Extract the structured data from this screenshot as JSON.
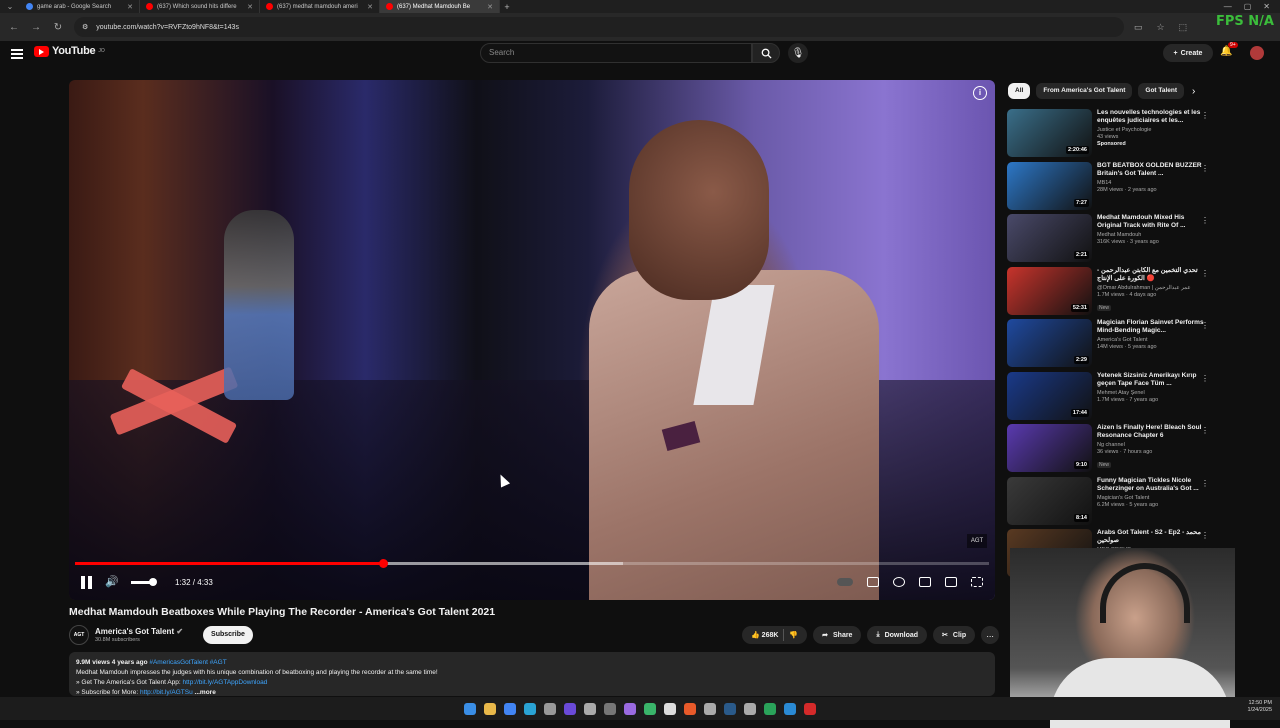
{
  "browser": {
    "tabs": [
      {
        "label": "game arab - Google Search",
        "color": "#4285f4",
        "active": false
      },
      {
        "label": "(637) Which sound hits differe",
        "color": "#ff0000",
        "active": false
      },
      {
        "label": "(637) medhat mamdouh ameri",
        "color": "#ff0000",
        "active": false
      },
      {
        "label": "(637) Medhat Mamdouh Be",
        "color": "#ff0000",
        "active": true
      }
    ],
    "url": "youtube.com/watch?v=RVFZto9hNF8&t=143s",
    "overlay_text": "FPS N/A"
  },
  "masthead": {
    "logo_text": "YouTube",
    "logo_sup": "JO",
    "search_placeholder": "Search",
    "create_label": "Create",
    "notification_count": "9+"
  },
  "player": {
    "current_time": "1:32",
    "duration": "4:33",
    "time_display": "1:32 / 4:33",
    "progress": 0.337,
    "buffered": 0.6,
    "volume": 0.35,
    "watermark": "AGT"
  },
  "video": {
    "title": "Medhat Mamdouh Beatboxes While Playing The Recorder - America's Got Talent 2021",
    "channel_name": "America's Got Talent",
    "channel_avatar_text": "AGT",
    "subscribers": "30.8M subscribers",
    "subscribe_label": "Subscribe",
    "likes": "268K",
    "share_label": "Share",
    "download_label": "Download",
    "clip_label": "Clip",
    "more_label": "...",
    "views_date": "9.9M views  4 years ago",
    "hashtags": "#AmericasGotTalent #AGT",
    "description_line1": "Medhat Mamdouh impresses the judges with his unique combination of beatboxing and playing the recorder at the same time!",
    "description_line2_prefix": "» Get The America's Got Talent App: ",
    "description_line2_link": "http://bit.ly/AGTAppDownload",
    "description_line3_prefix": "» Subscribe for More: ",
    "description_line3_link": "http://bit.ly/AGTSu",
    "description_more": "...more"
  },
  "chips": [
    "All",
    "From America's Got Talent",
    "Got Talent"
  ],
  "recommendations": [
    {
      "title": "Les nouvelles technologies et les enquêtes judiciaires et les...",
      "channel": "Justice et Psychologie",
      "meta": "43 views",
      "duration": "2:20:46",
      "extra": "Sponsored",
      "thumb": "#3a6f8a"
    },
    {
      "title": "BGT BEATBOX GOLDEN BUZZER Britain's Got Talent ...",
      "channel": "MB14",
      "meta": "28M views · 2 years ago",
      "duration": "7:27",
      "extra": "",
      "thumb": "#2d78c8"
    },
    {
      "title": "Medhat Mamdouh Mixed His Original Track with Rite Of ...",
      "channel": "Medhat Mamdouh",
      "meta": "316K views · 3 years ago",
      "duration": "2:21",
      "extra": "",
      "thumb": "#4a4a6a"
    },
    {
      "title": "تحدي التخمين مع الكابتن عبدالرحمن - الكورة على الإنتاج 🔴",
      "channel": "@Omar Abdulrahman | عمر عبدالرحمن",
      "meta": "1.7M views · 4 days ago",
      "duration": "52:31",
      "extra": "New",
      "thumb": "#c8342c"
    },
    {
      "title": "Magician Florian Sainvet Performs Mind-Bending Magic...",
      "channel": "America's Got Talent",
      "meta": "14M views · 5 years ago",
      "duration": "2:29",
      "extra": "",
      "thumb": "#1f4aa0"
    },
    {
      "title": "Yetenek Sizsiniz Amerikayı Kırıp geçen Tape Face Tüm ...",
      "channel": "Mehmet Atay Şenel",
      "meta": "1.7M views · 7 years ago",
      "duration": "17:44",
      "extra": "",
      "thumb": "#1a3a8a"
    },
    {
      "title": "Aizen Is Finally Here! Bleach Soul Resonance Chapter 6",
      "channel": "Ng channel",
      "meta": "36 views · 7 hours ago",
      "duration": "9:10",
      "extra": "New",
      "thumb": "#5a3ab0"
    },
    {
      "title": "Funny Magician Tickles Nicole Scherzinger on Australia's Got ...",
      "channel": "Magician's Got Talent",
      "meta": "6.2M views · 5 years ago",
      "duration": "8:14",
      "extra": "",
      "thumb": "#3a3a3a"
    },
    {
      "title": "Arabs Got Talent - S2 - Ep2 - محمد صولحين",
      "channel": "MBC GROUP",
      "meta": "",
      "duration": "",
      "extra": "",
      "thumb": "#5a3a22"
    }
  ],
  "clock": {
    "time": "12:50 PM",
    "date": "1/24/2025"
  },
  "taskbar_colors": [
    "#3a8ee6",
    "#e8b84a",
    "#4285f4",
    "#2aa3d4",
    "#999",
    "#6a4ad8",
    "#aaa",
    "#777",
    "#9a6ae0",
    "#3ab56a",
    "#ddd",
    "#e85a2a",
    "#aaa",
    "#2a5a8a",
    "#aaa",
    "#2aa35a",
    "#2a8ad4",
    "#d42a2a"
  ]
}
